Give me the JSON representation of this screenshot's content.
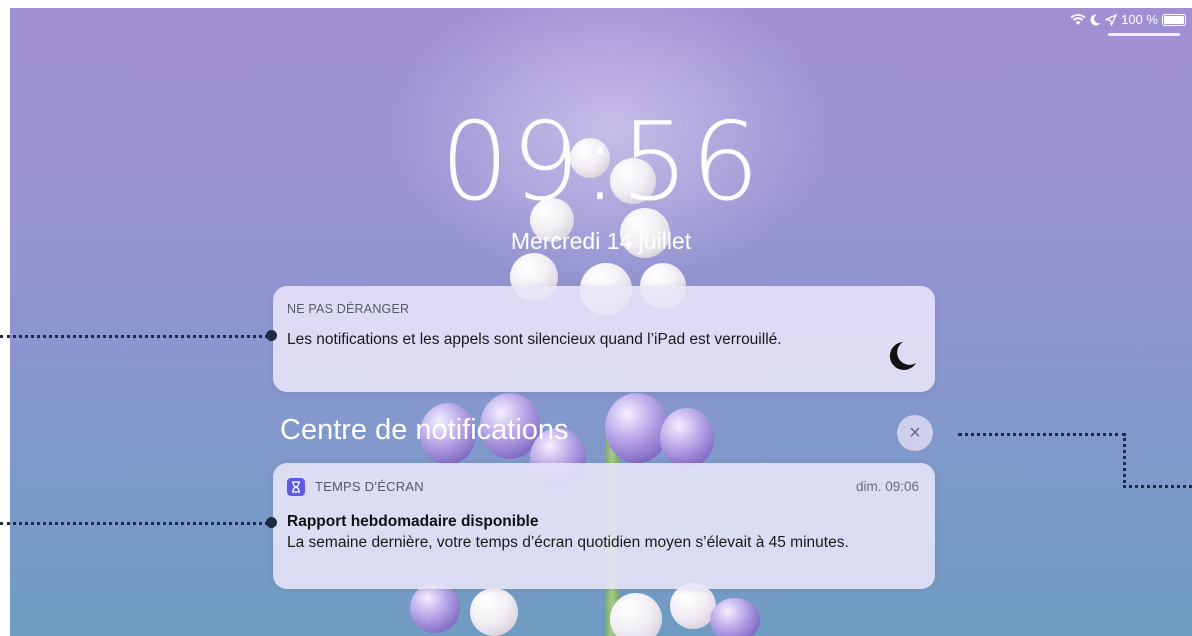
{
  "status_bar": {
    "battery": "100 %"
  },
  "lock": {
    "time": "09:56",
    "date": "Mercredi 14 juillet"
  },
  "dnd": {
    "header": "NE PAS DÉRANGER",
    "message": "Les notifications et les appels sont silencieux quand l’iPad est verrouillé.",
    "icon": "moon-icon"
  },
  "notification_center": {
    "title": "Centre de notifications",
    "close": "×"
  },
  "notification": {
    "app": "TEMPS D’ÉCRAN",
    "time": "dim. 09:06",
    "title": "Rapport hebdomadaire disponible",
    "body": "La semaine dernière, votre temps d’écran quotidien moyen s’élevait à 45 minutes.",
    "app_icon": "hourglass-icon"
  }
}
